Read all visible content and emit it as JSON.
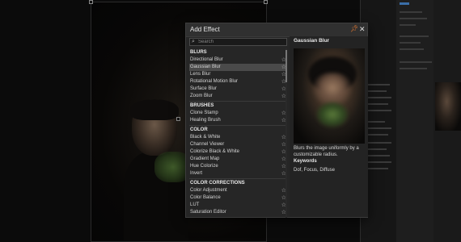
{
  "dialog": {
    "title": "Add Effect",
    "search_placeholder": "Search"
  },
  "categories": [
    {
      "name": "BLURS",
      "items": [
        "Directional Blur",
        "Gaussian Blur",
        "Lens Blur",
        "Rotational Motion Blur",
        "Surface Blur",
        "Zoom Blur"
      ]
    },
    {
      "name": "BRUSHES",
      "items": [
        "Clone Stamp",
        "Healing Brush"
      ]
    },
    {
      "name": "COLOR",
      "items": [
        "Black & White",
        "Channel Viewer",
        "Colorize Black & White",
        "Gradient Map",
        "Hue Colorize",
        "Invert"
      ]
    },
    {
      "name": "COLOR CORRECTIONS",
      "items": [
        "Color Adjustment",
        "Color Balance",
        "LUT",
        "Saturation Editor"
      ]
    }
  ],
  "selected_item": "Gaussian Blur",
  "preview": {
    "title": "Gaussian Blur",
    "description": "Blurs the image uniformly by a customizable radius.",
    "keywords_label": "Keywords",
    "keywords": "Dof, Focus, Diffuse"
  },
  "colors": {
    "accent_pin": "#e0762f",
    "selection_bg": "#4a4a4a",
    "dialog_bg": "#262626"
  },
  "icons": {
    "pin": "pin-icon",
    "close": "close-icon",
    "search": "search-icon",
    "favorite": "star-icon"
  }
}
